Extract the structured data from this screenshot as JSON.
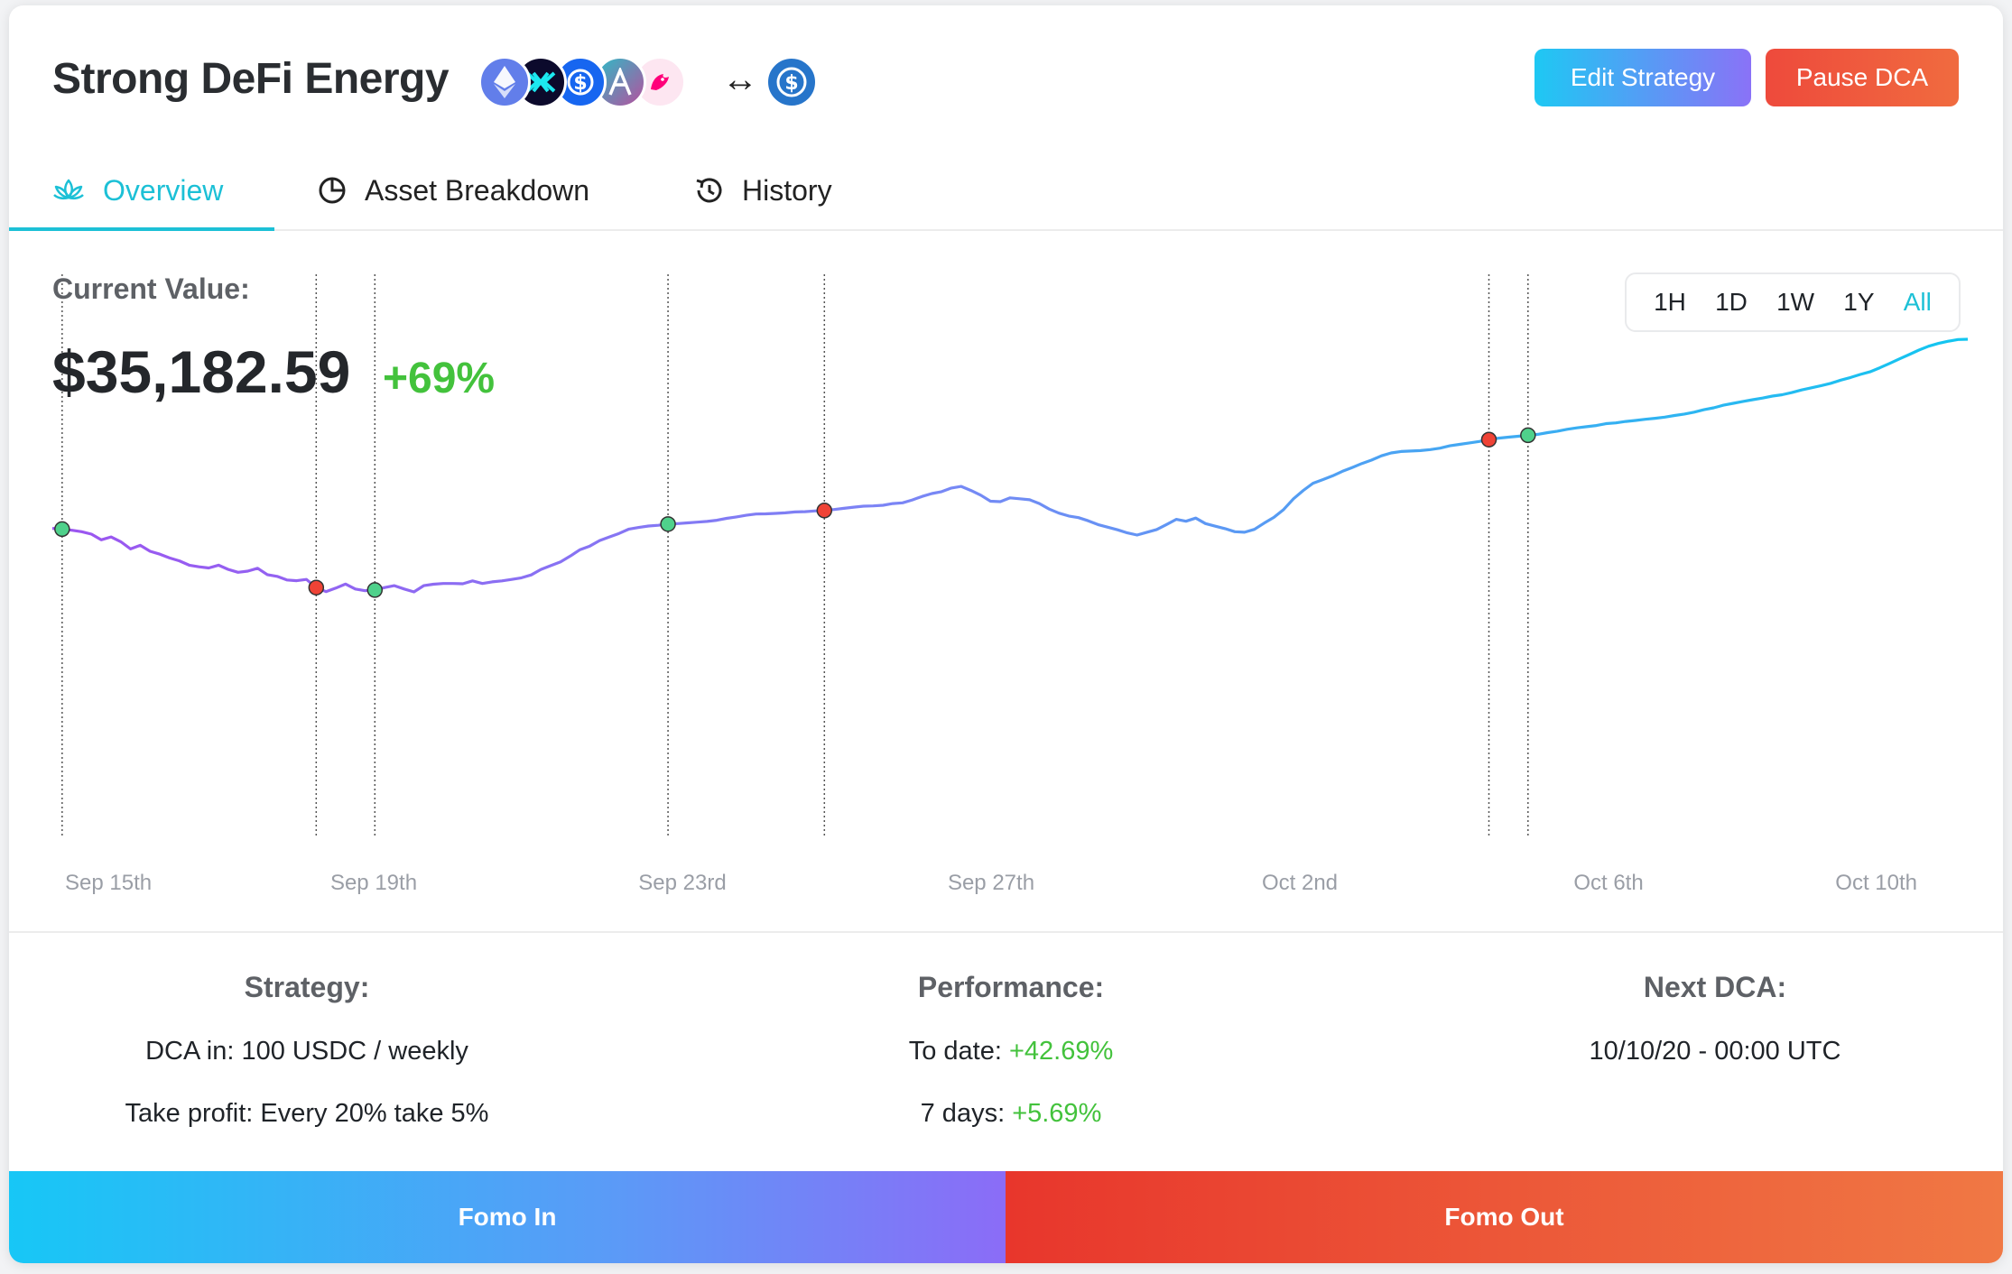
{
  "header": {
    "title": "Strong DeFi Energy",
    "tokens": [
      {
        "icon": "ethereum-icon",
        "color": "#627eea"
      },
      {
        "icon": "synthetix-icon",
        "color": "#0c0a2c"
      },
      {
        "icon": "yearn-icon",
        "color": "#1766f0"
      },
      {
        "icon": "aave-icon",
        "color": "#b55aaa"
      },
      {
        "icon": "uniswap-icon",
        "color": "#fbe4ee"
      }
    ],
    "arrow": "↔",
    "target_token": {
      "icon": "usdc-icon",
      "color": "#2775ca"
    },
    "edit_label": "Edit Strategy",
    "pause_label": "Pause DCA"
  },
  "tabs": [
    {
      "label": "Overview",
      "icon": "lotus-icon",
      "active": true
    },
    {
      "label": "Asset Breakdown",
      "icon": "pie-chart-icon",
      "active": false
    },
    {
      "label": "History",
      "icon": "history-icon",
      "active": false
    }
  ],
  "overview": {
    "current_value_label": "Current Value:",
    "current_value": "$35,182.59",
    "change": "+69%",
    "ranges": [
      "1H",
      "1D",
      "1W",
      "1Y",
      "All"
    ],
    "active_range": "All"
  },
  "chart_data": {
    "type": "line",
    "title": "",
    "x_labels": [
      "Sep 15th",
      "Sep 19th",
      "Sep 23rd",
      "Sep 27th",
      "Oct 2nd",
      "Oct 6th",
      "Oct 10th"
    ],
    "series": [
      {
        "values": [
          27260,
          27230,
          27180,
          27120,
          27020,
          26780,
          26900,
          26700,
          26400,
          26550,
          26300,
          26180,
          26020,
          25900,
          25720,
          25650,
          25600,
          25720,
          25540,
          25420,
          25470,
          25590,
          25320,
          25250,
          25100,
          25070,
          25120,
          24780,
          24610,
          24760,
          24930,
          24720,
          24650,
          24680,
          24780,
          24860,
          24720,
          24600,
          24860,
          24920,
          24950,
          24950,
          24940,
          25060,
          24950,
          25020,
          25060,
          25120,
          25190,
          25310,
          25540,
          25700,
          25860,
          26100,
          26370,
          26520,
          26750,
          26900,
          27050,
          27230,
          27300,
          27360,
          27390,
          27440,
          27460,
          27490,
          27520,
          27550,
          27600,
          27680,
          27740,
          27810,
          27860,
          27870,
          27890,
          27910,
          27950,
          27960,
          27990,
          28010,
          28050,
          28100,
          28150,
          28190,
          28200,
          28230,
          28300,
          28330,
          28450,
          28600,
          28720,
          28800,
          28950,
          29020,
          28850,
          28650,
          28400,
          28380,
          28540,
          28500,
          28460,
          28300,
          28070,
          27900,
          27780,
          27710,
          27580,
          27420,
          27310,
          27200,
          27070,
          26980,
          27100,
          27210,
          27420,
          27640,
          27560,
          27690,
          27460,
          27350,
          27250,
          27120,
          27100,
          27220,
          27480,
          27720,
          28050,
          28500,
          28850,
          29150,
          29300,
          29460,
          29650,
          29810,
          29980,
          30120,
          30300,
          30420,
          30480,
          30500,
          30520,
          30560,
          30620,
          30720,
          30780,
          30840,
          30900,
          30980,
          31040,
          31080,
          31120,
          31160,
          31200,
          31270,
          31330,
          31410,
          31470,
          31520,
          31570,
          31650,
          31680,
          31740,
          31780,
          31830,
          31870,
          31920,
          31990,
          32050,
          32130,
          32230,
          32310,
          32420,
          32500,
          32580,
          32650,
          32720,
          32800,
          32860,
          32950,
          33060,
          33150,
          33240,
          33340,
          33470,
          33580,
          33710,
          33820,
          33990,
          34170,
          34360,
          34540,
          34730,
          34890,
          35010,
          35100,
          35170,
          35182.59
        ]
      }
    ],
    "markers": [
      {
        "x_index": 1,
        "kind": "buy",
        "color": "#4fd18b"
      },
      {
        "x_index": 27,
        "kind": "sell",
        "color": "#ef4336"
      },
      {
        "x_index": 33,
        "kind": "buy",
        "color": "#4fd18b"
      },
      {
        "x_index": 63,
        "kind": "buy",
        "color": "#4fd18b"
      },
      {
        "x_index": 79,
        "kind": "sell",
        "color": "#ef4336"
      },
      {
        "x_index": 147,
        "kind": "sell",
        "color": "#ef4336"
      },
      {
        "x_index": 151,
        "kind": "buy",
        "color": "#4fd18b"
      }
    ],
    "grid": false,
    "legend": "none"
  },
  "stats": {
    "strategy": {
      "heading": "Strategy:",
      "line1": "DCA in: 100 USDC / weekly",
      "line2": "Take profit: Every 20% take 5%"
    },
    "performance": {
      "heading": "Performance:",
      "to_date_label": "To date:",
      "to_date": "+42.69%",
      "seven_days_label": "7 days:",
      "seven_days": "+5.69%"
    },
    "next_dca": {
      "heading": "Next DCA:",
      "value": "10/10/20 - 00:00 UTC"
    }
  },
  "footer": {
    "fomo_in": "Fomo In",
    "fomo_out": "Fomo Out"
  }
}
